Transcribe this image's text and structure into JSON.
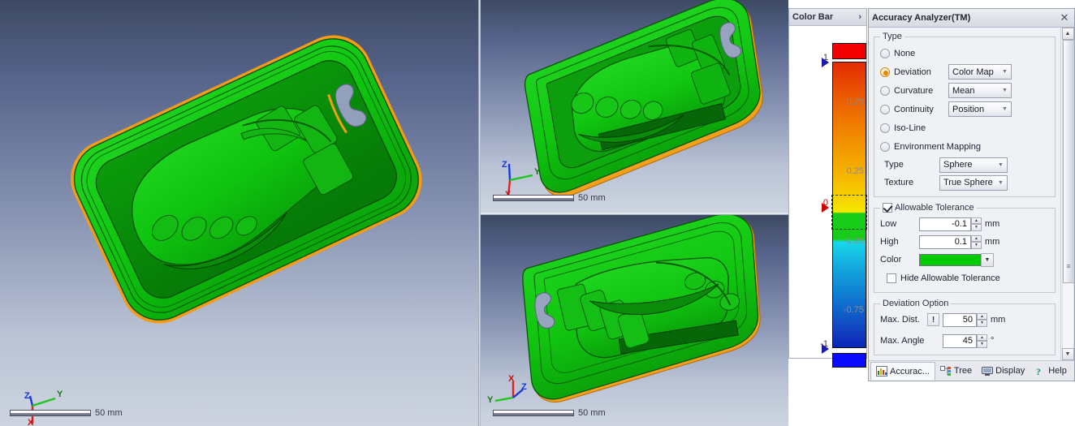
{
  "viewports": [
    {
      "id": "main",
      "triad": {
        "axes": [
          "Z",
          "Y",
          "X"
        ]
      },
      "scale_label": "50 mm"
    },
    {
      "id": "top-right",
      "triad": {
        "axes": [
          "Z",
          "Y",
          "X"
        ]
      },
      "scale_label": "50 mm"
    },
    {
      "id": "bottom-right",
      "triad": {
        "axes": [
          "X",
          "Y",
          "Z"
        ]
      },
      "scale_label": "50 mm"
    }
  ],
  "color_bar": {
    "title": "Color Bar",
    "pin_icon": "chevron-right-icon",
    "ticks": [
      "1",
      "0.75",
      "0.25",
      "0",
      "-0.25",
      "-0.75",
      "-1"
    ],
    "max_marker": "1",
    "zero_marker": "0",
    "min_marker": "-1",
    "over_color": "#f20000",
    "under_color": "#0a0aff",
    "tolerance_color": "#19cc19"
  },
  "analyzer": {
    "title": "Accuracy Analyzer(TM)",
    "close_icon": "close-icon",
    "type_group": {
      "legend": "Type",
      "options": [
        {
          "label": "None",
          "selected": false,
          "combo": null
        },
        {
          "label": "Deviation",
          "selected": true,
          "combo": "Color Map"
        },
        {
          "label": "Curvature",
          "selected": false,
          "combo": "Mean"
        },
        {
          "label": "Continuity",
          "selected": false,
          "combo": "Position"
        },
        {
          "label": "Iso-Line",
          "selected": false,
          "combo": null
        },
        {
          "label": "Environment Mapping",
          "selected": false,
          "combo": null
        }
      ],
      "type_label": "Type",
      "type_value": "Sphere",
      "texture_label": "Texture",
      "texture_value": "True Sphere"
    },
    "tolerance_group": {
      "legend": "Allowable Tolerance",
      "checked": true,
      "low_label": "Low",
      "low_value": "-0.1",
      "low_unit": "mm",
      "high_label": "High",
      "high_value": "0.1",
      "high_unit": "mm",
      "color_label": "Color",
      "color_value": "#00cc00",
      "hide_label": "Hide Allowable Tolerance",
      "hide_checked": false
    },
    "deviation_group": {
      "legend": "Deviation Option",
      "max_dist_label": "Max. Dist.",
      "max_dist_warn": "!",
      "max_dist_value": "50",
      "max_dist_unit": "mm",
      "max_angle_label": "Max. Angle",
      "max_angle_value": "45",
      "max_angle_unit": "°"
    },
    "tabs": [
      {
        "label": "Accurac...",
        "icon": "chart-icon",
        "active": true
      },
      {
        "label": "Tree",
        "icon": "tree-icon",
        "active": false
      },
      {
        "label": "Display",
        "icon": "monitor-icon",
        "active": false
      },
      {
        "label": "Help",
        "icon": "help-icon",
        "active": false
      }
    ]
  }
}
